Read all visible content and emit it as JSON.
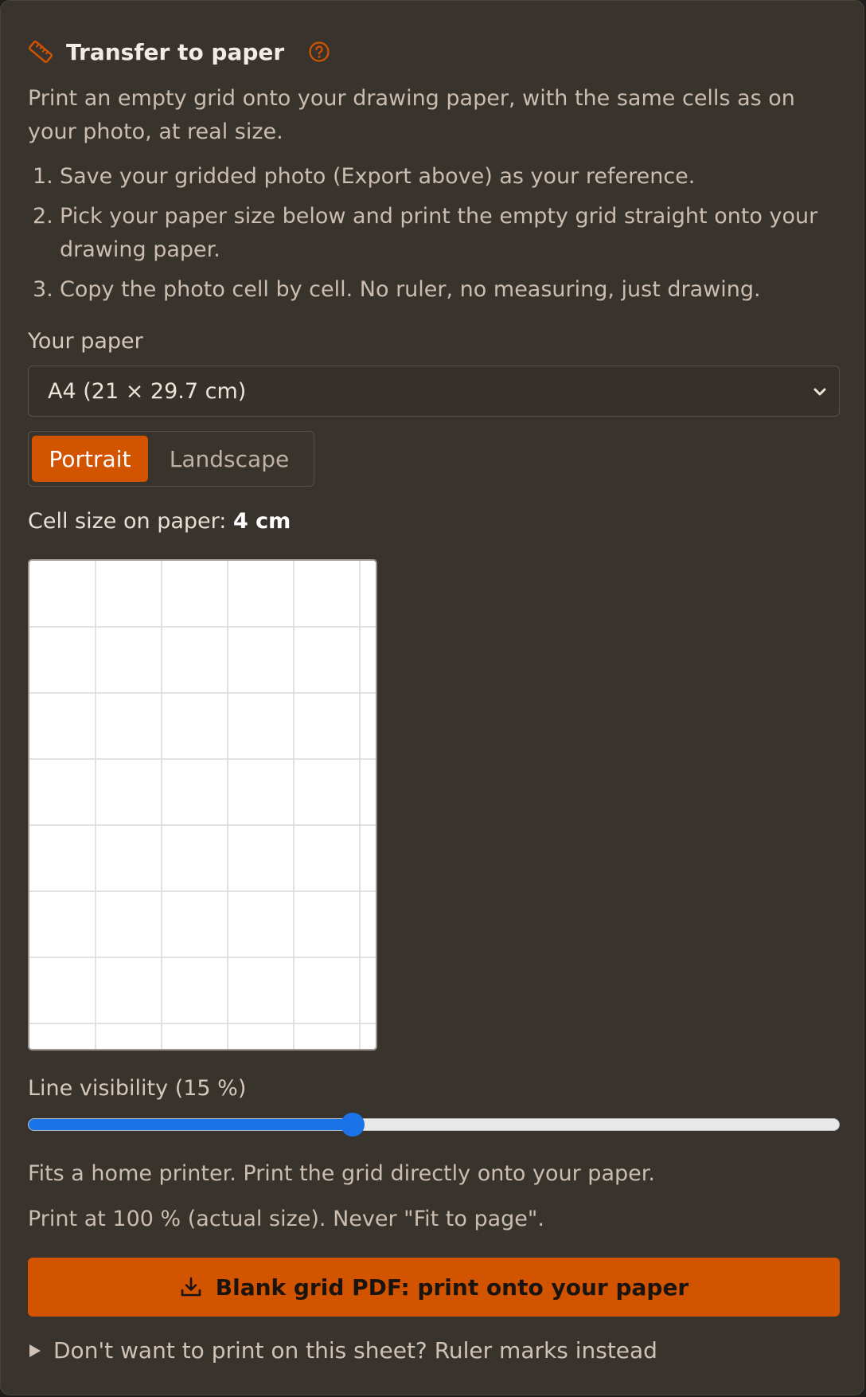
{
  "header": {
    "title": "Transfer to paper",
    "icon": "ruler-icon",
    "help_icon": "help-icon"
  },
  "intro": "Print an empty grid onto your drawing paper, with the same cells as on your photo, at real size.",
  "steps": [
    {
      "num": "1.",
      "text": "Save your gridded photo (Export above) as your reference."
    },
    {
      "num": "2.",
      "text": "Pick your paper size below and print the empty grid straight onto your drawing paper."
    },
    {
      "num": "3.",
      "text": "Copy the photo cell by cell. No ruler, no measuring, just drawing."
    }
  ],
  "paper": {
    "label": "Your paper",
    "selected": "A4 (21 × 29.7 cm)"
  },
  "orientation": {
    "options": [
      "Portrait",
      "Landscape"
    ],
    "selected": "Portrait"
  },
  "cell_size": {
    "label": "Cell size on paper:",
    "value": "4 cm"
  },
  "line_visibility": {
    "label": "Line visibility (15 %)",
    "fraction": 0.4
  },
  "notes": {
    "fits": "Fits a home printer. Print the grid directly onto your paper.",
    "print_scale": "Print at 100 % (actual size). Never \"Fit to page\"."
  },
  "download_button": {
    "label": "Blank grid PDF: print onto your paper",
    "icon": "download-icon"
  },
  "ruler_marks_toggle": "Don't want to print on this sheet? Ruler marks instead",
  "colors": {
    "accent": "#d35400",
    "panel_bg": "#39332e",
    "slider": "#1a73e8"
  }
}
